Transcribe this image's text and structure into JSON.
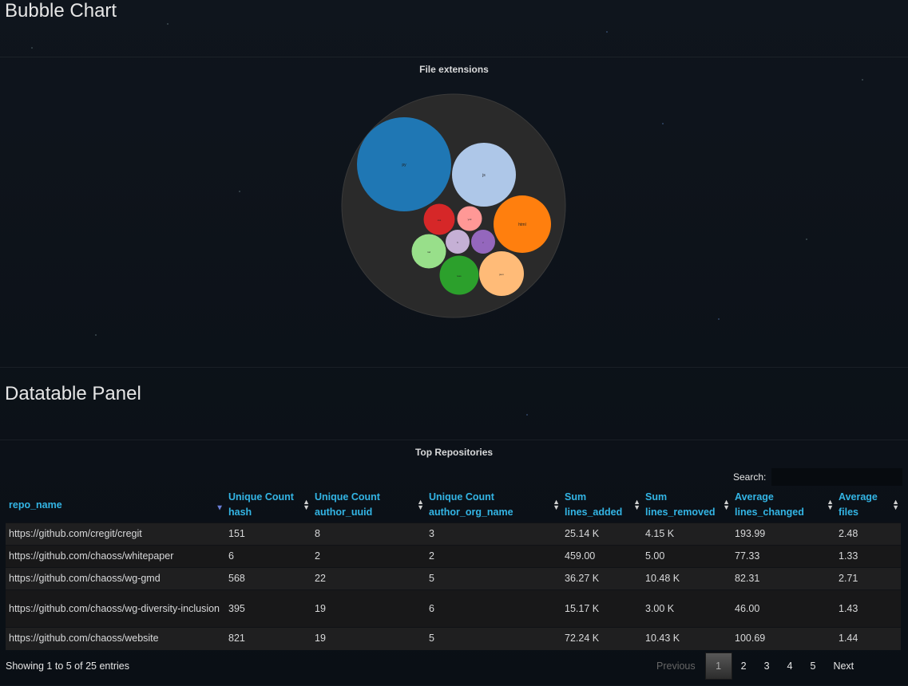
{
  "bubble_row": {
    "title": "Bubble Chart"
  },
  "bubble_panel": {
    "title": "File extensions"
  },
  "chart_data": {
    "type": "bubble",
    "title": "File extensions",
    "outer_color": "#2a2a2a",
    "bubbles": [
      {
        "label": "py",
        "value": 100,
        "color": "#1f77b4"
      },
      {
        "label": "js",
        "value": 45,
        "color": "#aec7e8"
      },
      {
        "label": "html",
        "value": 34,
        "color": "#ff7f0e"
      },
      {
        "label": "json",
        "value": 21,
        "color": "#ffbb78"
      },
      {
        "label": "less",
        "value": 16,
        "color": "#2ca02c"
      },
      {
        "label": "md",
        "value": 13,
        "color": "#98df8a"
      },
      {
        "label": "css",
        "value": 11,
        "color": "#d62728"
      },
      {
        "label": "yml",
        "value": 7,
        "color": "#ff9896"
      },
      {
        "label": "c",
        "value": 6,
        "color": "#9467bd"
      },
      {
        "label": "h",
        "value": 6,
        "color": "#c5b0d5"
      }
    ]
  },
  "table_row": {
    "title": "Datatable Panel"
  },
  "table_panel": {
    "title": "Top Repositories"
  },
  "search": {
    "label": "Search:",
    "value": ""
  },
  "table": {
    "columns": [
      {
        "l1": "repo_name",
        "l2": ""
      },
      {
        "l1": "Unique Count",
        "l2": "hash"
      },
      {
        "l1": "Unique Count",
        "l2": "author_uuid"
      },
      {
        "l1": "Unique Count",
        "l2": "author_org_name"
      },
      {
        "l1": "Sum",
        "l2": "lines_added"
      },
      {
        "l1": "Sum",
        "l2": "lines_removed"
      },
      {
        "l1": "Average",
        "l2": "lines_changed"
      },
      {
        "l1": "Average",
        "l2": "files"
      }
    ],
    "rows": [
      [
        "https://github.com/cregit/cregit",
        "151",
        "8",
        "3",
        "25.14 K",
        "4.15 K",
        "193.99",
        "2.48"
      ],
      [
        "https://github.com/chaoss/whitepaper",
        "6",
        "2",
        "2",
        "459.00",
        "5.00",
        "77.33",
        "1.33"
      ],
      [
        "https://github.com/chaoss/wg-gmd",
        "568",
        "22",
        "5",
        "36.27 K",
        "10.48 K",
        "82.31",
        "2.71"
      ],
      [
        "https://github.com/chaoss/wg-diversity-inclusion",
        "395",
        "19",
        "6",
        "15.17 K",
        "3.00 K",
        "46.00",
        "1.43"
      ],
      [
        "https://github.com/chaoss/website",
        "821",
        "19",
        "5",
        "72.24 K",
        "10.43 K",
        "100.69",
        "1.44"
      ]
    ],
    "info": "Showing 1 to 5 of 25 entries"
  },
  "pagination": {
    "previous": "Previous",
    "pages": [
      "1",
      "2",
      "3",
      "4",
      "5"
    ],
    "current": "1",
    "next": "Next"
  }
}
